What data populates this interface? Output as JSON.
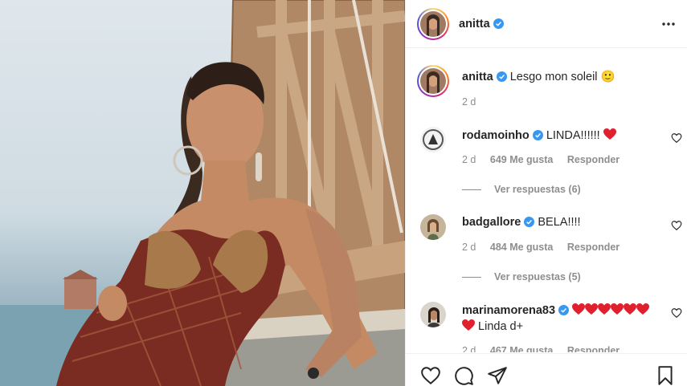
{
  "post": {
    "author": "anitta",
    "caption_text": "Lesgo mon soleil",
    "caption_emoji": "🙂",
    "caption_time": "2 d"
  },
  "comments": [
    {
      "username": "rodamoinho",
      "text": "LINDA!!!!!!",
      "time": "2 d",
      "likes": "649 Me gusta",
      "reply_label": "Responder",
      "view_replies": "Ver respuestas (6)"
    },
    {
      "username": "badgallore",
      "text": "BELA!!!!",
      "time": "2 d",
      "likes": "484 Me gusta",
      "reply_label": "Responder",
      "view_replies": "Ver respuestas (5)"
    },
    {
      "username": "marinamorena83",
      "text_line2": "Linda d+",
      "time": "2 d",
      "likes": "467 Me gusta",
      "reply_label": "Responder"
    }
  ],
  "icons": {
    "verified": "verified-badge-icon",
    "more": "more-options-icon",
    "like": "heart-icon",
    "comment": "comment-icon",
    "share": "share-icon",
    "save": "bookmark-icon"
  },
  "colors": {
    "verified_blue": "#3897f0",
    "heart_red": "#ed4956",
    "muted_text": "#8e8e8e"
  }
}
